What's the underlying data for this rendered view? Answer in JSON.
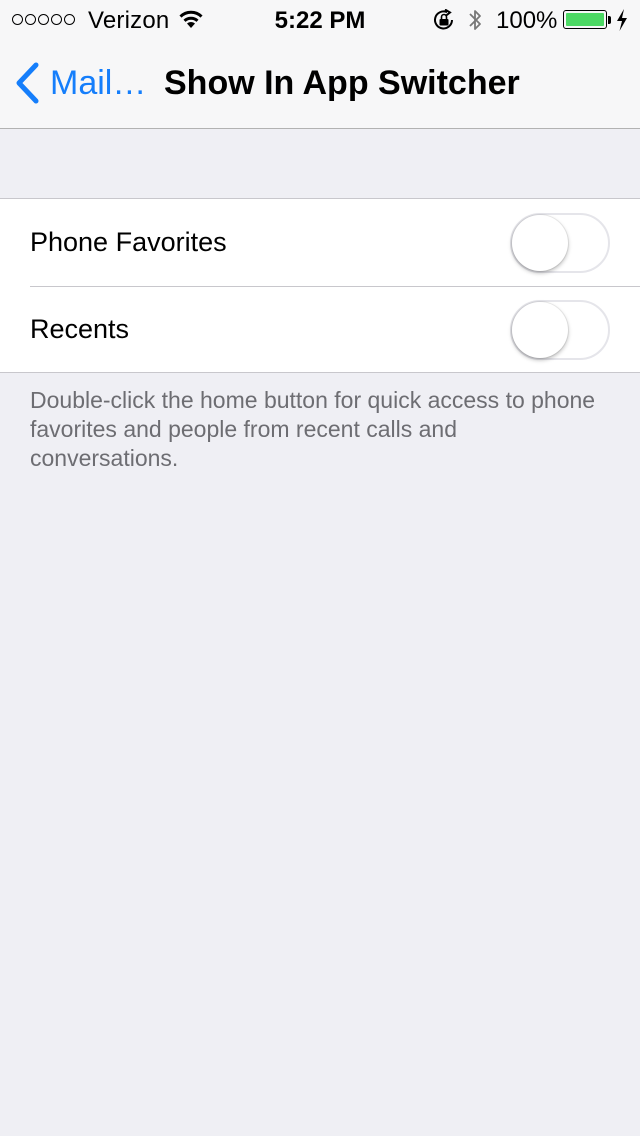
{
  "status_bar": {
    "carrier": "Verizon",
    "time": "5:22 PM",
    "battery_percent": "100%",
    "battery_level": 1.0,
    "battery_color": "#4cd964",
    "signal_dots_filled": 0,
    "signal_dots_total": 5
  },
  "nav": {
    "back_label": "Mail…",
    "title": "Show In App Switcher",
    "accent": "#157efb"
  },
  "settings": {
    "rows": [
      {
        "label": "Phone Favorites",
        "enabled": false
      },
      {
        "label": "Recents",
        "enabled": false
      }
    ],
    "footer": "Double-click the home button for quick access to phone favorites and people from recent calls and conversations."
  }
}
